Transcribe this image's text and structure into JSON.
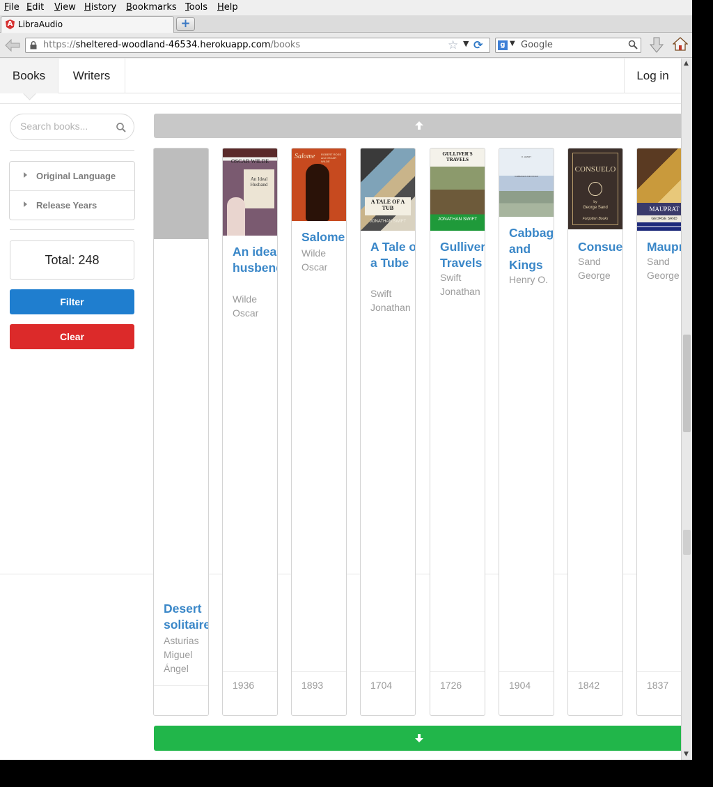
{
  "browser": {
    "menu": [
      "File",
      "Edit",
      "View",
      "History",
      "Bookmarks",
      "Tools",
      "Help"
    ],
    "tab_title": "LibraAudio",
    "new_tab": "+",
    "url_prefix": "https://",
    "url_host": "sheltered-woodland-46534.herokuapp.com",
    "url_path": "/books",
    "search_engine": "Google",
    "search_placeholder": "Google",
    "accent": "#2e78c6"
  },
  "app": {
    "nav": {
      "books": "Books",
      "writers": "Writers",
      "login": "Log in"
    },
    "sidebar": {
      "search_placeholder": "Search books...",
      "filters": [
        "Original Language",
        "Release Years"
      ],
      "total_label": "Total: 248",
      "filter_button": "Filter",
      "clear_button": "Clear"
    },
    "colors": {
      "link": "#3a87c8",
      "filter": "#1f7ecf",
      "clear": "#dc2a2a",
      "load_more": "#21b64a"
    },
    "books": [
      {
        "title": "Desert solitaire",
        "author": "Asturias Miguel Ángel",
        "year": ""
      },
      {
        "title": "An ideal husbend",
        "author": "Wilde Oscar",
        "year": "1936"
      },
      {
        "title": "Salome",
        "author": "Wilde Oscar",
        "year": "1893"
      },
      {
        "title": "A Tale of a Tube",
        "author": "Swift Jonathan",
        "year": "1704"
      },
      {
        "title": "Gulliver`s Travels",
        "author": "Swift Jonathan",
        "year": "1726"
      },
      {
        "title": "Cabbages and Kings",
        "author": "Henry O.",
        "year": "1904"
      },
      {
        "title": "Consuelo",
        "author": "Sand George",
        "year": "1842"
      },
      {
        "title": "Mauprat",
        "author": "Sand George",
        "year": "1837"
      }
    ],
    "covers": {
      "ideal": {
        "series": "",
        "author": "OSCAR WILDE",
        "title": "An Ideal Husband"
      },
      "salome": {
        "title": "Salome",
        "authors": "ROBERT ROSS and OSCAR WILDE"
      },
      "tub": {
        "title": "A TALE OF A TUB",
        "author": "JONATHAN SWIFT"
      },
      "gulliver": {
        "title": "GULLIVER'S TRAVELS",
        "author": "JONATHAN SWIFT"
      },
      "cabbages": {
        "line1": "O. HENRY",
        "line2": "CABBAGES AND KINGS"
      },
      "consuelo": {
        "title": "CONSUELO",
        "by": "by",
        "author": "George Sand",
        "series": "Forgotten Books"
      },
      "mauprat": {
        "title": "MAUPRAT",
        "author": "GEORGE SAND"
      }
    }
  }
}
